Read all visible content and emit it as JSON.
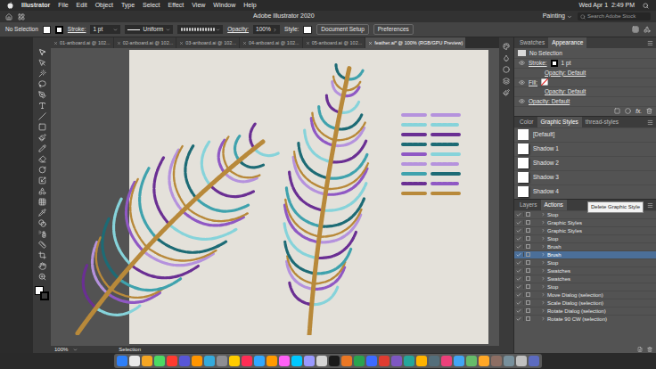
{
  "menu_bar": {
    "app": "Illustrator",
    "items": [
      "File",
      "Edit",
      "Object",
      "Type",
      "Select",
      "Effect",
      "View",
      "Window",
      "Help"
    ],
    "clock": "Wed Apr 1  2:49 PM"
  },
  "window": {
    "title": "Adobe Illustrator 2020",
    "workspace": "Painting",
    "search_placeholder": "Search Adobe Stock"
  },
  "control_bar": {
    "selection": "No Selection",
    "stroke_label": "Stroke:",
    "stroke_value": "1 pt",
    "profile": "Uniform",
    "opacity_label": "Opacity:",
    "opacity_value": "100%",
    "style_label": "Style:",
    "buttons": [
      "Document Setup",
      "Preferences"
    ]
  },
  "document_tabs": [
    {
      "label": "01-artboard.ai @ 102...",
      "selected": false
    },
    {
      "label": "02-artboard.ai @ 102...",
      "selected": false
    },
    {
      "label": "03-artboard.ai @ 102...",
      "selected": false
    },
    {
      "label": "04-artboard.ai @ 102...",
      "selected": false
    },
    {
      "label": "05-artboard.ai @ 102...",
      "selected": false
    },
    {
      "label": "feather.ai* @ 100% (RGB/GPU Preview)",
      "selected": true
    }
  ],
  "appearance_panel": {
    "tabs": [
      {
        "label": "Swatches",
        "selected": false
      },
      {
        "label": "Appearance",
        "selected": true
      }
    ],
    "title": "No Selection",
    "rows": [
      {
        "kind": "stroke",
        "label": "Stroke:",
        "value": "1 pt"
      },
      {
        "kind": "opacity",
        "label": "Opacity: Default"
      },
      {
        "kind": "fill",
        "label": "Fill:",
        "value": ""
      },
      {
        "kind": "opacity",
        "label": "Opacity: Default"
      },
      {
        "kind": "global",
        "label": "Opacity: Default"
      }
    ],
    "footer": "fx."
  },
  "graphic_styles_panel": {
    "tabs": [
      {
        "label": "Color",
        "selected": false
      },
      {
        "label": "Graphic Styles",
        "selected": true
      },
      {
        "label": "thread-styles",
        "selected": false
      }
    ],
    "items": [
      "[Default]",
      "Shadow 1",
      "Shadow 2",
      "Shadow 3",
      "Shadow 4"
    ]
  },
  "actions_panel": {
    "tabs": [
      {
        "label": "Layers",
        "selected": false
      },
      {
        "label": "Actions",
        "selected": true
      }
    ],
    "tooltip": "Delete Graphic Style",
    "items": [
      {
        "label": "Stop",
        "checked": true,
        "selected": false
      },
      {
        "label": "Graphic Styles",
        "checked": true,
        "selected": false
      },
      {
        "label": "Graphic Styles",
        "checked": true,
        "selected": false
      },
      {
        "label": "Stop",
        "checked": true,
        "selected": false
      },
      {
        "label": "Brush",
        "checked": true,
        "selected": false
      },
      {
        "label": "Brush",
        "checked": true,
        "selected": true
      },
      {
        "label": "Stop",
        "checked": true,
        "selected": false
      },
      {
        "label": "Swatches",
        "checked": true,
        "selected": false
      },
      {
        "label": "Swatches",
        "checked": true,
        "selected": false
      },
      {
        "label": "Stop",
        "checked": true,
        "selected": false
      },
      {
        "label": "Move Dialog (selection)",
        "checked": true,
        "selected": false
      },
      {
        "label": "Scale Dialog (selection)",
        "checked": true,
        "selected": false
      },
      {
        "label": "Rotate Dialog (selection)",
        "checked": true,
        "selected": false
      },
      {
        "label": "Rotate 90 CW (selection)",
        "checked": true,
        "selected": false
      }
    ]
  },
  "status_bar": {
    "zoom": "100%",
    "tool": "Selection"
  }
}
